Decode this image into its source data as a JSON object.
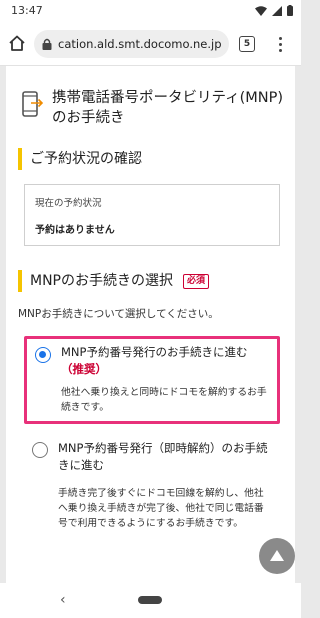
{
  "status_bar": {
    "time": "13:47"
  },
  "browser": {
    "url": "cation.ald.smt.docomo.ne.jp",
    "tab_count": "5"
  },
  "page": {
    "title": "携帯電話番号ポータビリティ(MNP)のお手続き",
    "reservation_section": {
      "heading": "ご予約状況の確認",
      "status_label": "現在の予約状況",
      "status_value": "予約はありません"
    },
    "mnp_section": {
      "heading": "MNPのお手続きの選択",
      "required_badge": "必須",
      "instruction": "MNPお手続きについて選択してください。",
      "options": [
        {
          "title": "MNP予約番号発行のお手続きに進む",
          "recommended": "（推奨）",
          "description": "他社へ乗り換えと同時にドコモを解約するお手続きです。",
          "selected": true
        },
        {
          "title": "MNP予約番号発行（即時解約）のお手続きに進む",
          "description": "手続き完了後すぐにドコモ回線を解約し、他社へ乗り換え手続きが完了後、他社で同じ電話番号で利用できるようにするお手続きです。",
          "selected": false
        }
      ]
    }
  },
  "colors": {
    "accent_yellow": "#f5c400",
    "highlight_pink": "#e8317a",
    "required_red": "#cc0033",
    "radio_blue": "#1a73e8"
  },
  "icons": [
    "wifi-icon",
    "signal-icon",
    "battery-icon",
    "home-icon",
    "lock-icon",
    "more-vert-icon",
    "phone-transfer-icon",
    "arrow-up-icon",
    "back-icon"
  ]
}
